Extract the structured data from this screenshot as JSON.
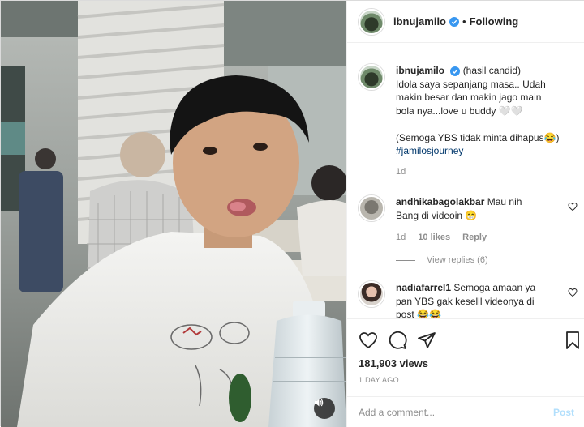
{
  "header": {
    "username": "ibnujamilo",
    "separator": "•",
    "follow_status": "Following"
  },
  "caption": {
    "username": "ibnujamilo",
    "lines": [
      "(hasil candid)",
      "Idola saya sepanjang masa.. Udah",
      "makin besar dan makin jago main",
      "bola nya...love u buddy 🤍🤍"
    ],
    "line2": "(Semoga YBS tidak minta dihapus😂)",
    "hashtag": "#jamilosjourney",
    "time": "1d"
  },
  "comments": [
    {
      "username": "andhikabagolakbar",
      "text_line1": "Mau nih",
      "text_line2": "Bang di videoin 😁",
      "time": "1d",
      "likes": "10 likes",
      "reply": "Reply",
      "view_replies": "View replies (6)"
    },
    {
      "username": "nadiafarrel1",
      "text_line1": "Semoga amaan ya",
      "text_line2": "pan YBS gak keselll videonya di",
      "text_line3": "post 😂😂"
    }
  ],
  "stats": {
    "views": "181,903 views",
    "date": "1 DAY AGO"
  },
  "add_comment": {
    "placeholder": "Add a comment...",
    "post_label": "Post"
  },
  "icons": {
    "like": "heart-icon",
    "comment": "comment-icon",
    "share": "share-icon",
    "save": "bookmark-icon",
    "sound": "speaker-icon",
    "verified": "verified-badge-icon"
  },
  "colors": {
    "verified": "#3897f0",
    "post_disabled": "#b2dffc",
    "muted": "#8e8e8e",
    "hashtag": "#00376b"
  }
}
